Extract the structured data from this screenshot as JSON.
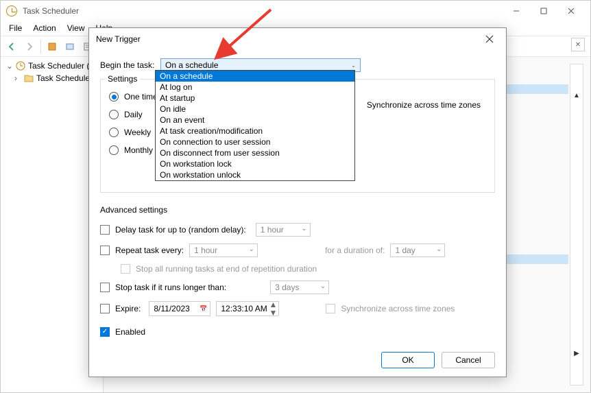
{
  "app": {
    "title": "Task Scheduler"
  },
  "menubar": {
    "file": "File",
    "action": "Action",
    "view": "View",
    "help": "Help"
  },
  "tree": {
    "root": "Task Scheduler (L",
    "child": "Task Scheduler"
  },
  "dialog": {
    "title": "New Trigger",
    "begin_label": "Begin the task:",
    "begin_value": "On a schedule",
    "options": {
      "on_schedule": "On a schedule",
      "at_logon": "At log on",
      "at_startup": "At startup",
      "on_idle": "On idle",
      "on_event": "On an event",
      "at_creation": "At task creation/modification",
      "on_connect": "On connection to user session",
      "on_disconnect": "On disconnect from user session",
      "on_lock": "On workstation lock",
      "on_unlock": "On workstation unlock"
    },
    "settings_legend": "Settings",
    "radio": {
      "one_time": "One time",
      "daily": "Daily",
      "weekly": "Weekly",
      "monthly": "Monthly"
    },
    "sync_zones": "Synchronize across time zones",
    "advanced_legend": "Advanced settings",
    "delay_label": "Delay task for up to (random delay):",
    "delay_value": "1 hour",
    "repeat_label": "Repeat task every:",
    "repeat_value": "1 hour",
    "duration_label": "for a duration of:",
    "duration_value": "1 day",
    "stop_all_label": "Stop all running tasks at end of repetition duration",
    "stop_longer_label": "Stop task if it runs longer than:",
    "stop_longer_value": "3 days",
    "expire_label": "Expire:",
    "expire_date": "8/11/2023",
    "expire_time": "12:33:10 AM",
    "sync_zones_disabled": "Synchronize across time zones",
    "enabled_label": "Enabled",
    "ok": "OK",
    "cancel": "Cancel"
  }
}
